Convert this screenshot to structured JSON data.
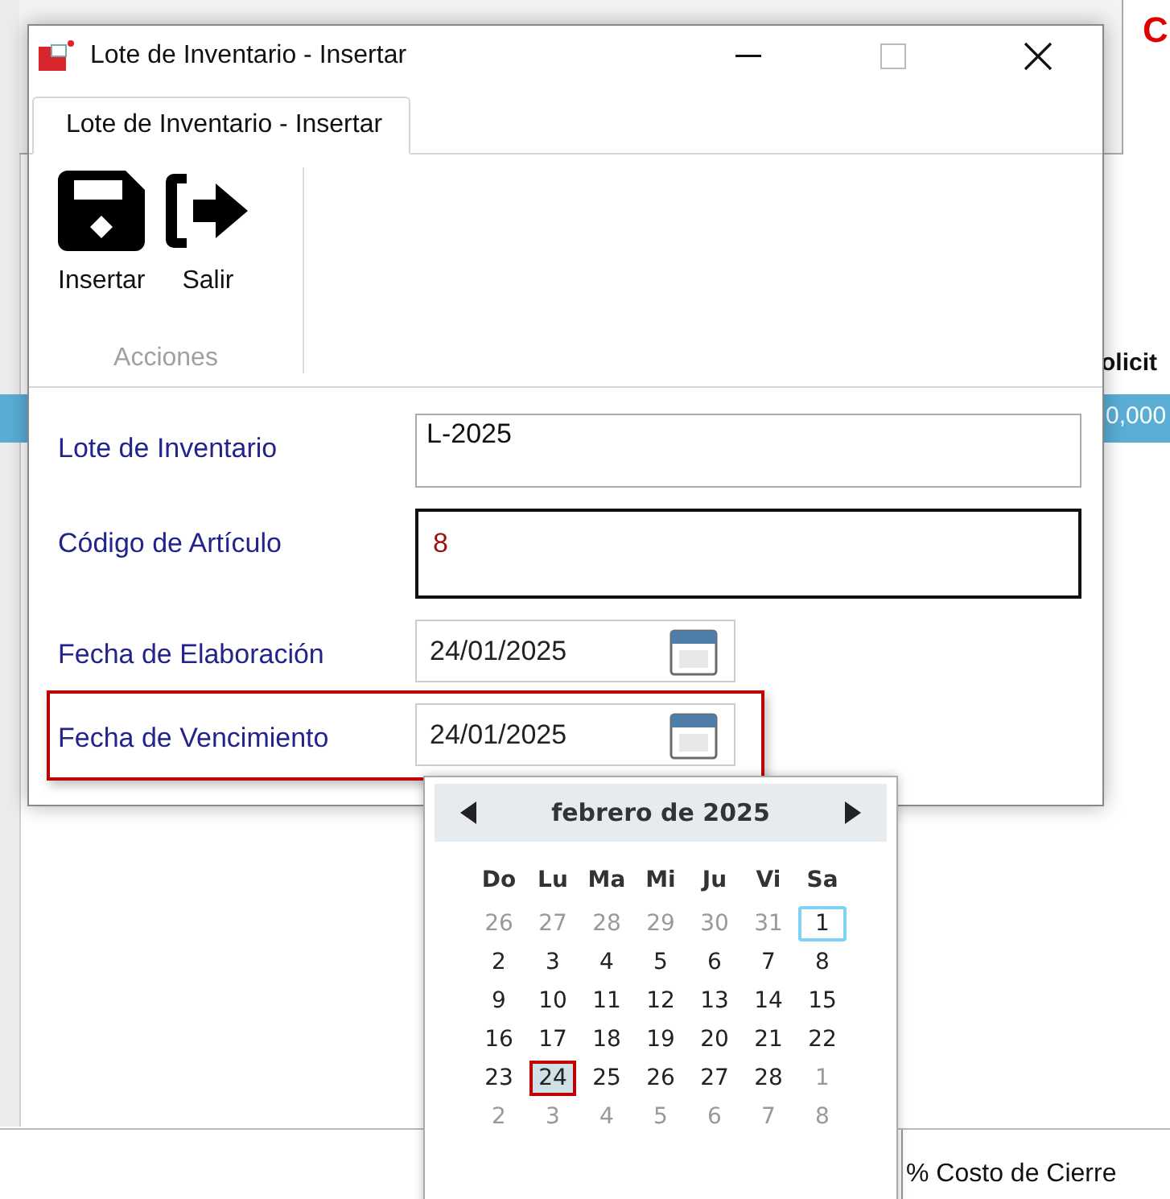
{
  "background_app": {
    "title_fragment": "C",
    "column_header_fragment": "olicit",
    "cell_fragment": "0,000",
    "footer_label": "% Costo de Cierre"
  },
  "window": {
    "title": "Lote de Inventario - Insertar"
  },
  "tabs": [
    {
      "label": "Lote de Inventario - Insertar",
      "selected": true
    }
  ],
  "ribbon": {
    "group": "Acciones",
    "buttons": [
      {
        "kind": "save",
        "label": "Insertar"
      },
      {
        "kind": "exit",
        "label": "Salir"
      }
    ]
  },
  "fields": [
    {
      "kind": "text",
      "label": "Lote de Inventario",
      "value": "L-2025",
      "focused": false,
      "highlighted": false
    },
    {
      "kind": "text",
      "label": "Código de Artículo",
      "value": "8",
      "focused": true,
      "highlighted": false
    },
    {
      "kind": "date",
      "label": "Fecha de Elaboración",
      "value": "24/01/2025",
      "focused": false,
      "highlighted": false
    },
    {
      "kind": "date",
      "label": "Fecha de Vencimiento",
      "value": "24/01/2025",
      "focused": false,
      "highlighted": true
    }
  ],
  "calendar": {
    "month": "febrero de 2025",
    "weekdays": [
      "Do",
      "Lu",
      "Ma",
      "Mi",
      "Ju",
      "Vi",
      "Sa"
    ],
    "weeks": [
      [
        {
          "d": "26",
          "muted": true,
          "selected": false,
          "today": false
        },
        {
          "d": "27",
          "muted": true,
          "selected": false,
          "today": false
        },
        {
          "d": "28",
          "muted": true,
          "selected": false,
          "today": false
        },
        {
          "d": "29",
          "muted": true,
          "selected": false,
          "today": false
        },
        {
          "d": "30",
          "muted": true,
          "selected": false,
          "today": false
        },
        {
          "d": "31",
          "muted": true,
          "selected": false,
          "today": false
        },
        {
          "d": "1",
          "muted": false,
          "selected": false,
          "today": true
        }
      ],
      [
        {
          "d": "2",
          "muted": false,
          "selected": false,
          "today": false
        },
        {
          "d": "3",
          "muted": false,
          "selected": false,
          "today": false
        },
        {
          "d": "4",
          "muted": false,
          "selected": false,
          "today": false
        },
        {
          "d": "5",
          "muted": false,
          "selected": false,
          "today": false
        },
        {
          "d": "6",
          "muted": false,
          "selected": false,
          "today": false
        },
        {
          "d": "7",
          "muted": false,
          "selected": false,
          "today": false
        },
        {
          "d": "8",
          "muted": false,
          "selected": false,
          "today": false
        }
      ],
      [
        {
          "d": "9",
          "muted": false,
          "selected": false,
          "today": false
        },
        {
          "d": "10",
          "muted": false,
          "selected": false,
          "today": false
        },
        {
          "d": "11",
          "muted": false,
          "selected": false,
          "today": false
        },
        {
          "d": "12",
          "muted": false,
          "selected": false,
          "today": false
        },
        {
          "d": "13",
          "muted": false,
          "selected": false,
          "today": false
        },
        {
          "d": "14",
          "muted": false,
          "selected": false,
          "today": false
        },
        {
          "d": "15",
          "muted": false,
          "selected": false,
          "today": false
        }
      ],
      [
        {
          "d": "16",
          "muted": false,
          "selected": false,
          "today": false
        },
        {
          "d": "17",
          "muted": false,
          "selected": false,
          "today": false
        },
        {
          "d": "18",
          "muted": false,
          "selected": false,
          "today": false
        },
        {
          "d": "19",
          "muted": false,
          "selected": false,
          "today": false
        },
        {
          "d": "20",
          "muted": false,
          "selected": false,
          "today": false
        },
        {
          "d": "21",
          "muted": false,
          "selected": false,
          "today": false
        },
        {
          "d": "22",
          "muted": false,
          "selected": false,
          "today": false
        }
      ],
      [
        {
          "d": "23",
          "muted": false,
          "selected": false,
          "today": false
        },
        {
          "d": "24",
          "muted": false,
          "selected": true,
          "today": false
        },
        {
          "d": "25",
          "muted": false,
          "selected": false,
          "today": false
        },
        {
          "d": "26",
          "muted": false,
          "selected": false,
          "today": false
        },
        {
          "d": "27",
          "muted": false,
          "selected": false,
          "today": false
        },
        {
          "d": "28",
          "muted": false,
          "selected": false,
          "today": false
        },
        {
          "d": "1",
          "muted": true,
          "selected": false,
          "today": false
        }
      ],
      [
        {
          "d": "2",
          "muted": true,
          "selected": false,
          "today": false
        },
        {
          "d": "3",
          "muted": true,
          "selected": false,
          "today": false
        },
        {
          "d": "4",
          "muted": true,
          "selected": false,
          "today": false
        },
        {
          "d": "5",
          "muted": true,
          "selected": false,
          "today": false
        },
        {
          "d": "6",
          "muted": true,
          "selected": false,
          "today": false
        },
        {
          "d": "7",
          "muted": true,
          "selected": false,
          "today": false
        },
        {
          "d": "8",
          "muted": true,
          "selected": false,
          "today": false
        }
      ]
    ]
  }
}
